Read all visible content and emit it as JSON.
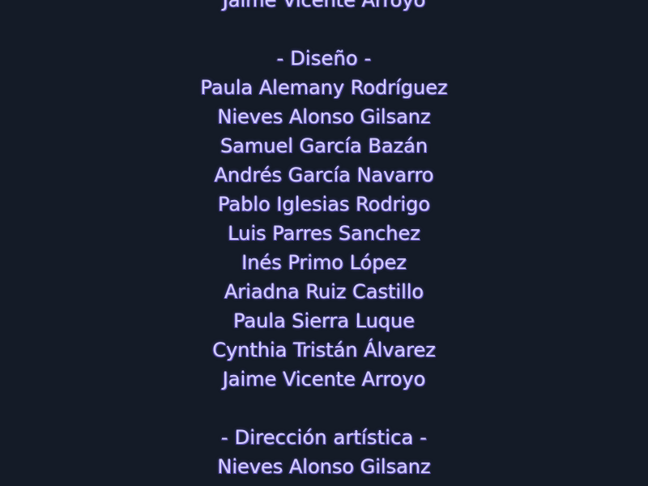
{
  "credits": {
    "prev_name": "Jaime Vicente Arroyo",
    "sections": [
      {
        "title": "- Diseño -",
        "names": [
          "Paula Alemany Rodríguez",
          "Nieves Alonso Gilsanz",
          "Samuel García Bazán",
          "Andrés García Navarro",
          "Pablo Iglesias Rodrigo",
          "Luis Parres Sanchez",
          "Inés Primo López",
          "Ariadna Ruiz Castillo",
          "Paula Sierra Luque",
          "Cynthia Tristán Álvarez",
          "Jaime Vicente Arroyo"
        ]
      },
      {
        "title": "- Dirección artística -",
        "names": [
          "Nieves Alonso Gilsanz"
        ]
      }
    ]
  },
  "colors": {
    "background": "#141b27",
    "text": "#d6cfff",
    "glow": "#6a5cc4"
  }
}
